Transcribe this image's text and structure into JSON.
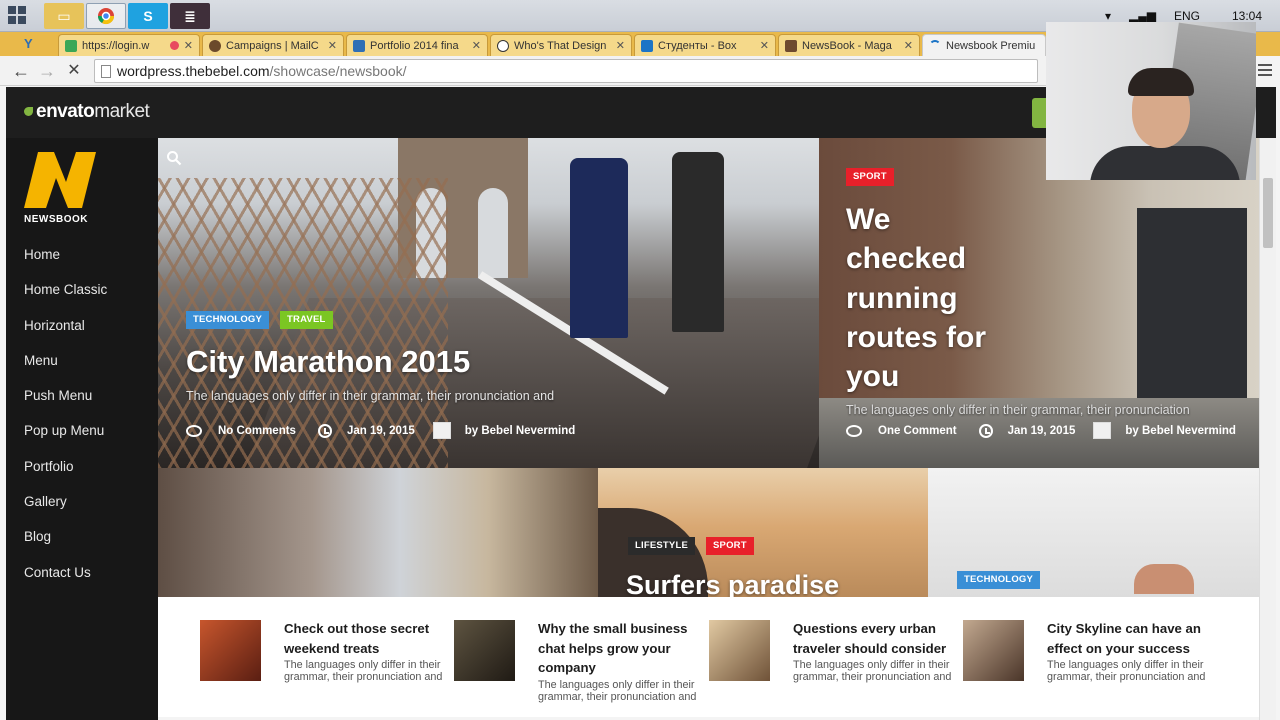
{
  "taskbar": {
    "lang": "ENG",
    "time": "13:04"
  },
  "tabs": [
    {
      "title": "https://login.w",
      "favicon_color": "#3aa757"
    },
    {
      "title": "Campaigns | MailC",
      "favicon_color": "#6b4a2b"
    },
    {
      "title": "Portfolio 2014 fina",
      "favicon_color": "#2f6fb5"
    },
    {
      "title": "Who's That Design",
      "favicon_color": "#333333"
    },
    {
      "title": "Студенты - Box",
      "favicon_color": "#1b74c6"
    },
    {
      "title": "NewsBook - Maga",
      "favicon_color": "#6e4a2f"
    },
    {
      "title": "Newsbook Premiu",
      "favicon_color": "#1b74c6"
    }
  ],
  "address": {
    "domain": "wordpress.thebebel.com",
    "path": "/showcase/newsbook/"
  },
  "envato": {
    "logo_main": "envato",
    "logo_sub": "market",
    "accent": "#82b541"
  },
  "brand": {
    "letter": "N",
    "name": "NEWSBOOK",
    "color": "#f5b400"
  },
  "nav": [
    "Home",
    "Home Classic",
    "Horizontal",
    "Menu",
    "Push Menu",
    "Pop up Menu",
    "Portfolio",
    "Gallery",
    "Blog",
    "Contact Us"
  ],
  "hero_main": {
    "badges": [
      {
        "label": "TECHNOLOGY",
        "color": "#3a8fd6"
      },
      {
        "label": "TRAVEL",
        "color": "#7bc623"
      }
    ],
    "title": "City Marathon 2015",
    "excerpt": "The languages only differ in their grammar, their pronunciation and",
    "comments": "No Comments",
    "date": "Jan 19, 2015",
    "author": "by Bebel Nevermind"
  },
  "hero_side": {
    "badge": {
      "label": "SPORT",
      "color": "#e8202a"
    },
    "title_lines": [
      "We",
      "checked",
      "running",
      "routes for",
      "you"
    ],
    "excerpt": "The languages only differ in their grammar, their pronunciation",
    "comments": "One Comment",
    "date": "Jan 19, 2015",
    "author": "by Bebel Nevermind"
  },
  "tiles": {
    "surf_badges": [
      {
        "label": "LIFESTYLE",
        "color": "#2b2b2b"
      },
      {
        "label": "SPORT",
        "color": "#e8202a"
      }
    ],
    "surf_title": "Surfers paradise",
    "tech_badge": {
      "label": "TECHNOLOGY",
      "color": "#3a8fd6"
    }
  },
  "cards": [
    {
      "title": "Check out those secret weekend treats",
      "excerpt": "The languages only differ in their grammar, their pronunciation and",
      "thumb": "#8b3a24"
    },
    {
      "title": "Why the small business chat helps grow your company",
      "excerpt": "The languages only differ in their grammar, their pronunciation and",
      "thumb": "#3c3429"
    },
    {
      "title": "Questions every urban traveler should consider",
      "excerpt": "The languages only differ in their grammar, their pronunciation and",
      "thumb": "#b5956e"
    },
    {
      "title": "City Skyline can have an effect on your success",
      "excerpt": "The languages only differ in their grammar, their pronunciation and",
      "thumb": "#7a6152"
    }
  ]
}
